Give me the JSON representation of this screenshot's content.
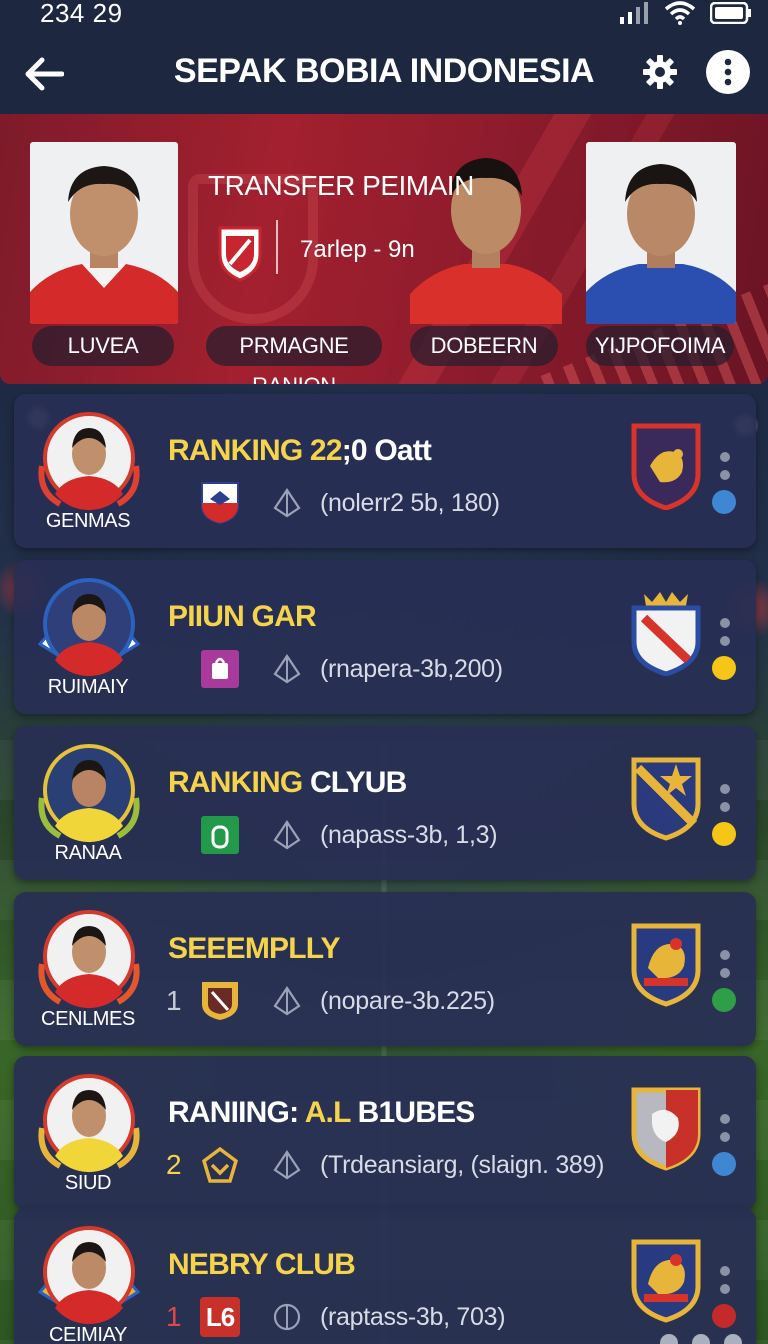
{
  "status_bar": {
    "time": "234 29"
  },
  "app_bar": {
    "title": "SEPAK BOBIA INDONESIA"
  },
  "hero": {
    "heading": "TRANSFER PEIMAIN",
    "subheading": "7arlep - 9n",
    "pills": [
      "LUVEA",
      "PRMAGNE RANION",
      "DOBEERN",
      "YIJPOFOIMA"
    ]
  },
  "colors": {
    "accent": "#f5d44b",
    "card_bg": "#282e54",
    "hero_red": "#a3202f",
    "status_blue": "#3f86d3",
    "status_yellow": "#f5c518",
    "status_green": "#2e9e48",
    "status_red": "#c42a2a"
  },
  "cards": [
    {
      "avatar_label": "GENMAS",
      "title_accent": "RANKING 22",
      "title_rest": ";0 Oatt",
      "number": "",
      "meta_text": "(nolerr2 5b, 180)",
      "status": "blue"
    },
    {
      "avatar_label": "RUIMAIY",
      "title_accent": "PIIUN GAR",
      "title_rest": "",
      "number": "",
      "meta_text": "(rnapera-3b,200)",
      "status": "yellow"
    },
    {
      "avatar_label": "RANAA",
      "title_accent": "RANKING",
      "title_rest": " CLYUB",
      "number": "",
      "meta_text": "(napass-3b, 1,3)",
      "status": "yellow"
    },
    {
      "avatar_label": "CENLMES",
      "title_accent": "SEEEMPLLY",
      "title_rest": "",
      "number": "1",
      "meta_text": "(nopare-3b.225)",
      "status": "green"
    },
    {
      "avatar_label": "SIUD",
      "title_accent": "A.L",
      "title_prefix": "RANIING: ",
      "title_rest": " B1UBES",
      "number": "2",
      "meta_text": "(Trdeansiarg, (slaign. 389)",
      "status": "blue"
    },
    {
      "avatar_label": "CEIMIAY",
      "title_accent": "NEBRY",
      "title_rest": " CLUB",
      "number": "1",
      "badge_text": "L6",
      "meta_text": "(raptass-3b, 703)",
      "status": "red"
    }
  ],
  "icons": [
    "back-arrow-icon",
    "gear-icon",
    "more-vertical-icon",
    "wifi-icon",
    "battery-icon",
    "signal-icon",
    "compass-icon"
  ]
}
